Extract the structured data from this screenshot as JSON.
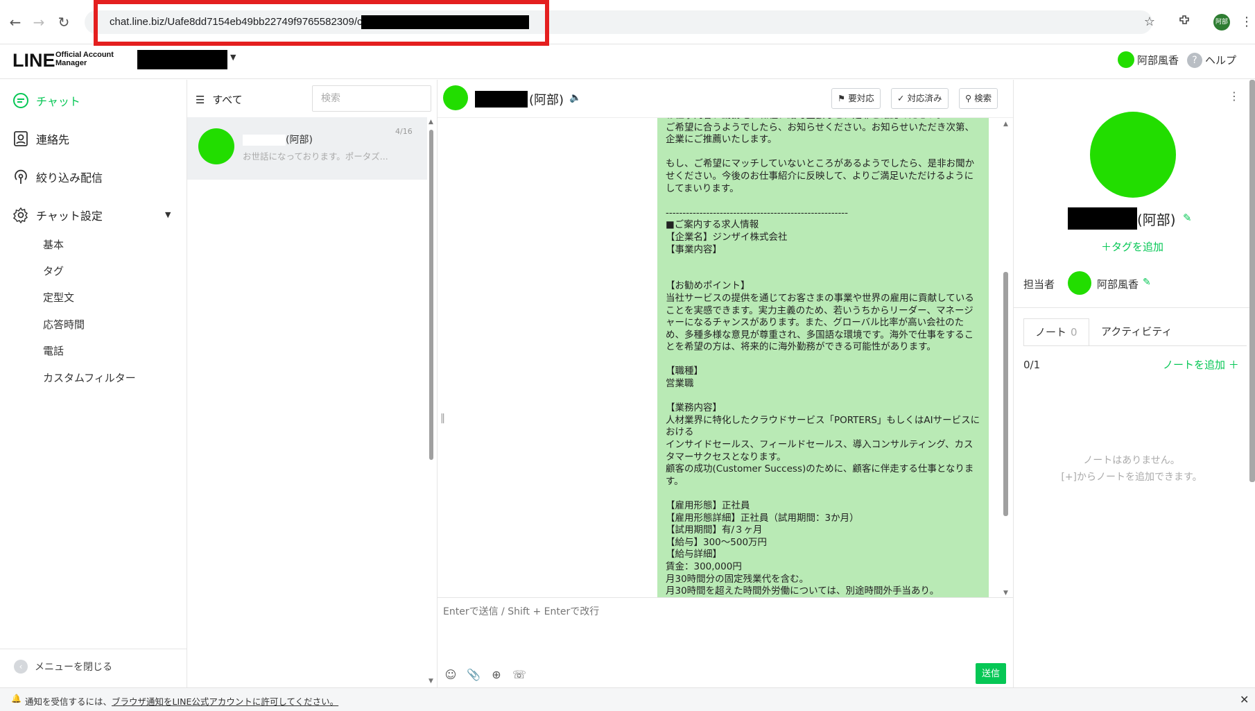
{
  "browser": {
    "url": "chat.line.biz/Uafe8dd7154eb49bb22749f9765582309/chat/",
    "avatar_label": "阿部"
  },
  "header": {
    "logo_main": "LINE",
    "logo_sub": "Official Account Manager",
    "user_name": "阿部風香",
    "help_label": "ヘルプ",
    "help_icon_text": "?"
  },
  "sidebar": {
    "items": [
      {
        "label": "チャット",
        "icon": "chat-icon",
        "active": true
      },
      {
        "label": "連絡先",
        "icon": "contacts-icon"
      },
      {
        "label": "絞り込み配信",
        "icon": "broadcast-icon"
      },
      {
        "label": "チャット設定",
        "icon": "settings-icon"
      }
    ],
    "sub_items": [
      "基本",
      "タグ",
      "定型文",
      "応答時間",
      "電話",
      "カスタムフィルター"
    ],
    "collapse_label": "メニューを閉じる"
  },
  "chat_list": {
    "filter_label": "すべて",
    "search_placeholder": "検索",
    "items": [
      {
        "name": "(阿部)",
        "preview": "お世話になっております。ポータズ...",
        "date": "4/16"
      }
    ]
  },
  "chat": {
    "contact_name": "(阿部)",
    "buttons": [
      "要対応",
      "対応済み",
      "検索"
    ],
    "message": "お仕事内容、勤務地、職種、給与金額など、是非ご確認ください。\nご希望に合うようでしたら、お知らせください。お知らせいただき次第、企業にご推薦いたします。\n\nもし、ご希望にマッチしていないところがあるようでしたら、是非お聞かせください。今後のお仕事紹介に反映して、よりご満足いただけるようにしてまいります。\n\n------------------------------------------------------\n■ご案内する求人情報\n【企業名】ジンザイ株式会社\n【事業内容】\n\n\n【お勧めポイント】\n当社サービスの提供を通じてお客さまの事業や世界の雇用に貢献していることを実感できます。実力主義のため、若いうちからリーダー、マネージャーになるチャンスがあります。また、グローバル比率が高い会社のため、多種多様な意見が尊重され、多国語な環境です。海外で仕事をすることを希望の方は、将来的に海外勤務ができる可能性があります。\n\n【職種】\n営業職\n\n【業務内容】\n人材業界に特化したクラウドサービス「PORTERS」もしくはAIサービスにおける\nインサイドセールス、フィールドセールス、導入コンサルティング、カスタマーサクセスとなります。\n顧客の成功(Customer Success)のために、顧客に伴走する仕事となります。\n\n【雇用形態】正社員\n【雇用形態詳細】正社員（試用期間：3か月）\n【試用期間】有/３ヶ月\n【給与】300～500万円\n【給与詳細】\n賃金：300,000円\n月30時間分の固定残業代を含む。\n月30時間を超えた時間外労働については、別途時間外手当あり。",
    "composer_placeholder": "Enterで送信 / Shift + Enterで改行",
    "send_label": "送信"
  },
  "profile": {
    "name": "(阿部)",
    "add_tag_label": "＋タグを追加",
    "assignee_label": "担当者",
    "assignee_name": "阿部風香",
    "tabs": [
      {
        "label": "ノート",
        "count": "0"
      },
      {
        "label": "アクティビティ"
      }
    ],
    "note_count": "0/1",
    "add_note_label": "ノートを追加 ＋",
    "empty_line1": "ノートはありません。",
    "empty_line2": "[+]からノートを追加できます。"
  },
  "notice": {
    "prefix": "通知を受信するには、",
    "link": "ブラウザ通知をLINE公式アカウントに許可してください。"
  },
  "colors": {
    "accent": "#06c755",
    "avatar": "#22dd00",
    "bubble": "#b9eab5",
    "highlight": "#e41f1f"
  }
}
